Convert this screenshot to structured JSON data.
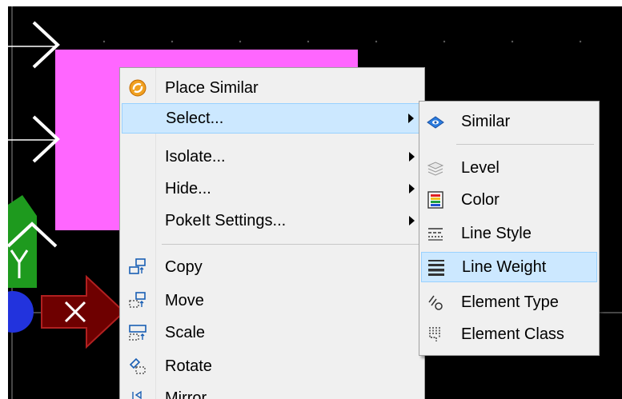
{
  "context_menu": {
    "items": [
      {
        "label": "Place Similar",
        "icon": "place-similar-icon"
      },
      {
        "label": "Select...",
        "icon": "",
        "submenu": true
      },
      {
        "label": "Isolate...",
        "icon": "",
        "submenu": true
      },
      {
        "label": "Hide...",
        "icon": "",
        "submenu": true
      },
      {
        "label": "PokeIt Settings...",
        "icon": "",
        "submenu": true
      },
      {
        "label": "Copy",
        "icon": "copy-icon"
      },
      {
        "label": "Move",
        "icon": "move-icon"
      },
      {
        "label": "Scale",
        "icon": "scale-icon"
      },
      {
        "label": "Rotate",
        "icon": "rotate-icon"
      },
      {
        "label": "Mirror",
        "icon": "mirror-icon"
      }
    ]
  },
  "select_submenu": {
    "items": [
      {
        "label": "Similar",
        "icon": "select-similar-icon"
      },
      {
        "label": "Level",
        "icon": "level-icon"
      },
      {
        "label": "Color",
        "icon": "color-icon"
      },
      {
        "label": "Line Style",
        "icon": "line-style-icon"
      },
      {
        "label": "Line Weight",
        "icon": "line-weight-icon"
      },
      {
        "label": "Element Type",
        "icon": "element-type-icon"
      },
      {
        "label": "Element Class",
        "icon": "element-class-icon"
      }
    ]
  },
  "colors": {
    "canvas_bg": "#000000",
    "magenta_shape": "#ff66ff",
    "green_shape": "#1e9a1e",
    "red_arrow": "#6e0000",
    "blue_circle": "#2233dd",
    "menu_bg": "#f0f0f0",
    "highlight_bg": "#cce8ff",
    "highlight_border": "#99d1ff"
  }
}
